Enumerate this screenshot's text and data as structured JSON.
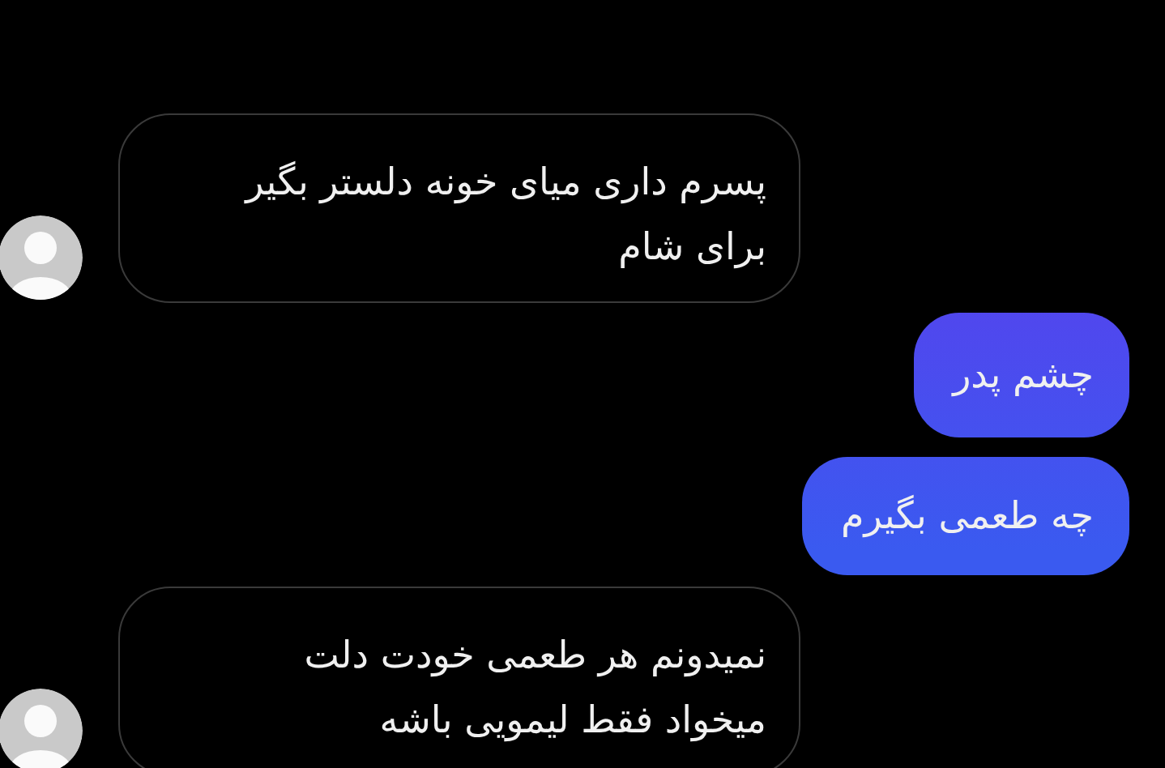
{
  "messages": [
    {
      "kind": "incoming",
      "lines": [
        "پسرم داری میای خونه دلستر بگیر",
        "برای شام"
      ]
    },
    {
      "kind": "outgoing",
      "lines": [
        "چشم پدر"
      ]
    },
    {
      "kind": "outgoing",
      "lines": [
        "چه طعمی بگیرم"
      ]
    },
    {
      "kind": "incoming",
      "lines": [
        "نمیدونم هر طعمی خودت دلت",
        "میخواد فقط لیمویی باشه"
      ]
    }
  ]
}
